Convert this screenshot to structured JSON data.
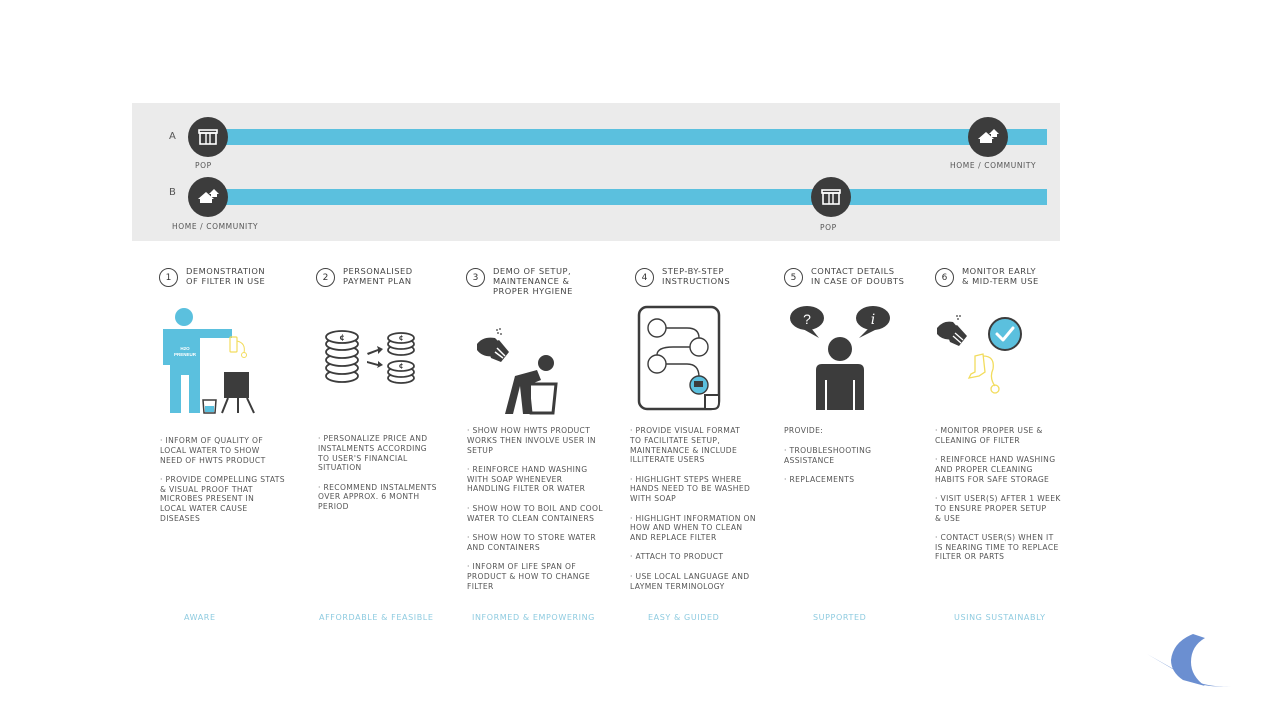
{
  "journey": {
    "rows": [
      {
        "letter": "A",
        "start_label": "POP",
        "start_icon": "shop-icon",
        "end_label": "HOME / COMMUNITY",
        "end_icon": "huts-icon"
      },
      {
        "letter": "B",
        "start_label": "HOME / COMMUNITY",
        "start_icon": "huts-icon",
        "end_label": "POP",
        "end_icon": "shop-icon"
      }
    ],
    "colors": {
      "bar": "#5bc0de",
      "node": "#3c3c3c",
      "panel": "#ebebeb"
    }
  },
  "steps": [
    {
      "number": "1",
      "title": "DEMONSTRATION\nOF FILTER IN USE",
      "illustration": "person-demonstrating-filter-icon",
      "figure_text": "H2O\nPRENEUR",
      "bullets": [
        "INFORM OF QUALITY OF\nLOCAL WATER TO SHOW\nNEED OF HWTS PRODUCT",
        "PROVIDE COMPELLING STATS\n& VISUAL PROOF THAT\nMICROBES PRESENT IN\nLOCAL WATER CAUSE\nDISEASES"
      ],
      "outcome": "AWARE"
    },
    {
      "number": "2",
      "title": "PERSONALISED\nPAYMENT PLAN",
      "illustration": "coins-split-icon",
      "bullets": [
        "PERSONALIZE PRICE AND\nINSTALMENTS ACCORDING\nTO USER'S FINANCIAL\nSITUATION",
        "RECOMMEND INSTALMENTS\nOVER APPROX. 6 MONTH\nPERIOD"
      ],
      "outcome": "AFFORDABLE & FEASIBLE"
    },
    {
      "number": "3",
      "title": "DEMO OF SETUP,\nMAINTENANCE &\nPROPER HYGIENE",
      "illustration": "handwash-and-bucket-icon",
      "bullets": [
        "SHOW HOW HWTS PRODUCT\nWORKS THEN INVOLVE USER IN\nSETUP",
        "REINFORCE HAND WASHING\nWITH SOAP WHENEVER\nHANDLING FILTER OR WATER",
        "SHOW HOW TO BOIL AND COOL\nWATER TO CLEAN CONTAINERS",
        "SHOW HOW TO STORE WATER\nAND CONTAINERS",
        "INFORM OF LIFE SPAN OF\nPRODUCT & HOW TO CHANGE\nFILTER"
      ],
      "outcome": "INFORMED & EMPOWERING"
    },
    {
      "number": "4",
      "title": "STEP-BY-STEP\nINSTRUCTIONS",
      "illustration": "flowchart-document-icon",
      "bullets": [
        "PROVIDE VISUAL FORMAT\nTO FACILITATE SETUP,\nMAINTENANCE & INCLUDE\nILLITERATE USERS",
        "HIGHLIGHT STEPS WHERE\nHANDS NEED TO BE WASHED\nWITH SOAP",
        "HIGHLIGHT INFORMATION ON\nHOW AND WHEN TO CLEAN\nAND REPLACE FILTER",
        "ATTACH TO PRODUCT",
        "USE LOCAL LANGUAGE AND\nLAYMEN TERMINOLOGY"
      ],
      "outcome": "EASY & GUIDED"
    },
    {
      "number": "5",
      "title": "CONTACT DETAILS\nIN CASE OF DOUBTS",
      "illustration": "person-with-speech-bubbles-icon",
      "bubble_left": "?",
      "bubble_right": "i",
      "lead": "PROVIDE:",
      "bullets": [
        "TROUBLESHOOTING\nASSISTANCE",
        "REPLACEMENTS"
      ],
      "outcome": "SUPPORTED"
    },
    {
      "number": "6",
      "title": "MONITOR EARLY\n& MID-TERM USE",
      "illustration": "handwash-check-filter-icon",
      "bullets": [
        "MONITOR PROPER USE &\nCLEANING OF FILTER",
        "REINFORCE HAND WASHING\nAND PROPER CLEANING\nHABITS FOR SAFE STORAGE",
        "VISIT USER(S) AFTER 1 WEEK\nTO ENSURE PROPER SETUP\n& USE",
        "CONTACT USER(S) WHEN IT\nIS NEARING TIME TO REPLACE\nFILTER OR PARTS"
      ],
      "outcome": "USING SUSTAINABLY"
    }
  ],
  "colors": {
    "accent_blue": "#5bc0de",
    "outcome_text": "#8ecbe0",
    "icon_dark": "#3c3c3c",
    "filter_yellow": "#f2dc5d",
    "logo": "#6b8fd1"
  },
  "logo": {
    "icon": "wave-sail-logo-icon"
  }
}
